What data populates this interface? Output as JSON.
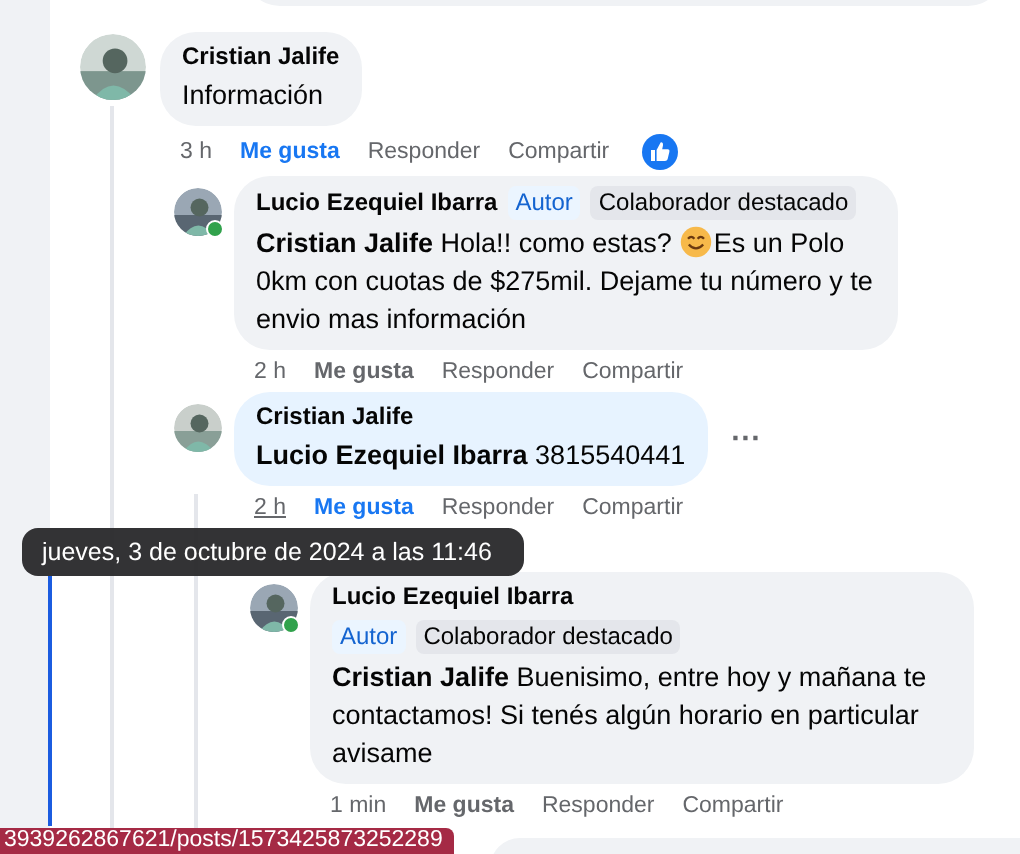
{
  "comments": [
    {
      "author": "Cristian Jalife",
      "text": "Información",
      "time": "3 h",
      "liked": true,
      "reacted": true,
      "actions": [
        "Me gusta",
        "Responder",
        "Compartir"
      ],
      "children": [
        {
          "author": "Lucio Ezequiel Ibarra",
          "badges": [
            {
              "kind": "author",
              "label": "Autor"
            },
            {
              "kind": "top",
              "label": "Colaborador destacado"
            }
          ],
          "mention": "Cristian Jalife",
          "text": "Hola!! como estas?",
          "smiley": true,
          "text_after": "Es un Polo 0km con cuotas de $275mil. Dejame tu número y te envio mas información",
          "time": "2 h",
          "liked": false,
          "online": true,
          "actions": [
            "Me gusta",
            "Responder",
            "Compartir"
          ]
        },
        {
          "author": "Cristian Jalife",
          "mention": "Lucio Ezequiel Ibarra",
          "text": "3815540441",
          "time": "2 h",
          "time_hovered": true,
          "liked": true,
          "highlighted": true,
          "more_label": "···",
          "actions": [
            "Me gusta",
            "Responder",
            "Compartir"
          ],
          "children": [
            {
              "author": "Lucio Ezequiel Ibarra",
              "badges": [
                {
                  "kind": "author",
                  "label": "Autor"
                },
                {
                  "kind": "top",
                  "label": "Colaborador destacado"
                }
              ],
              "badges_wrap": true,
              "mention": "Cristian Jalife",
              "text": "Buenisimo, entre hoy y mañana te contactamos! Si tenés algún horario en particular avisame",
              "time": "1 min",
              "liked": false,
              "online": true,
              "actions": [
                "Me gusta",
                "Responder",
                "Compartir"
              ]
            }
          ]
        }
      ]
    }
  ],
  "tooltip": {
    "text": "jueves, 3 de octubre de 2024 a las 11:46"
  },
  "status_bar": {
    "url": "3939262867621/posts/1573425873252289"
  }
}
